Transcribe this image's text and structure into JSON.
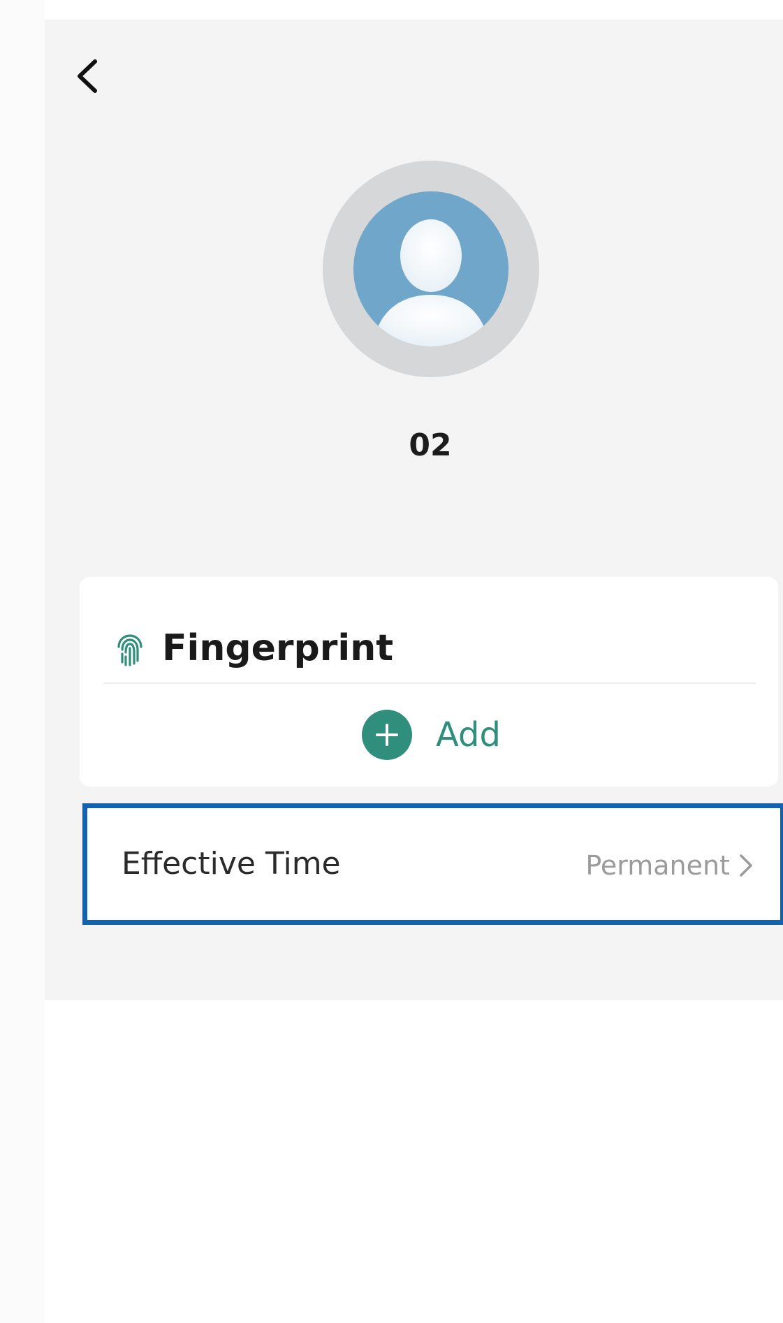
{
  "profile": {
    "name": "02"
  },
  "fingerprint": {
    "title": "Fingerprint",
    "add_label": "Add"
  },
  "effective_time": {
    "label": "Effective Time",
    "value": "Permanent"
  },
  "colors": {
    "accent": "#2f8f7c",
    "highlight_border": "#1262b0",
    "background": "#f4f4f5",
    "avatar": "#6fa6c9"
  },
  "icons": {
    "back": "chevron-left-icon",
    "avatar": "user-avatar-icon",
    "fingerprint": "fingerprint-icon",
    "add": "plus-circle-icon",
    "chevron": "chevron-right-icon"
  }
}
